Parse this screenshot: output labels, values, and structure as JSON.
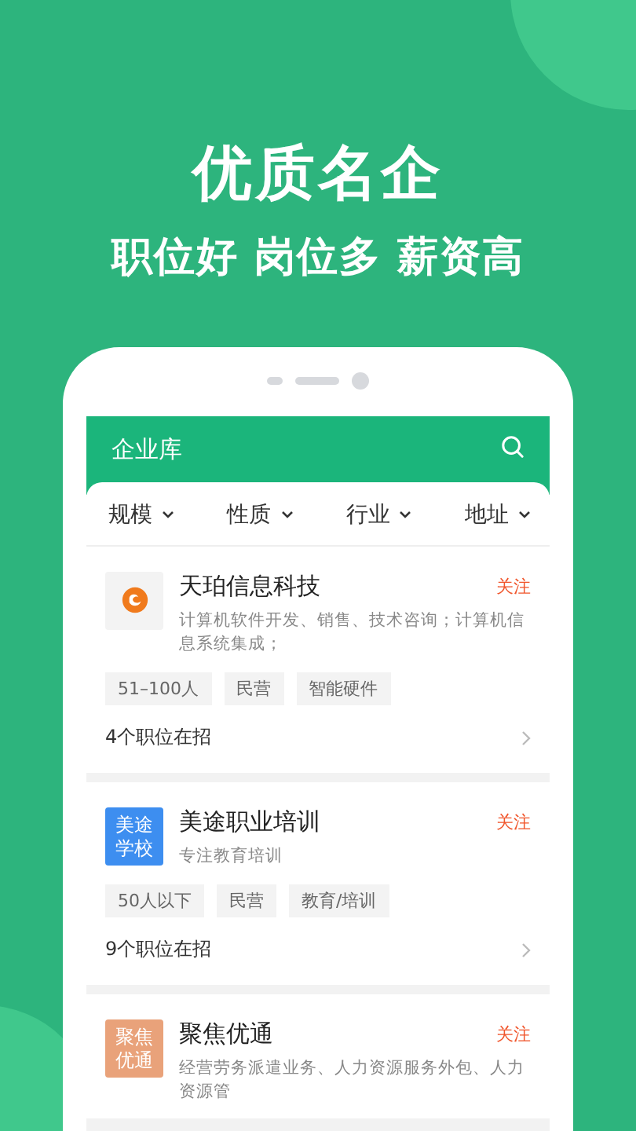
{
  "headline": "优质名企",
  "tagline": "职位好 岗位多 薪资高",
  "screen": {
    "title": "企业库",
    "filters": [
      {
        "label": "规模"
      },
      {
        "label": "性质"
      },
      {
        "label": "行业"
      },
      {
        "label": "地址"
      }
    ],
    "companies": [
      {
        "name": "天珀信息科技",
        "follow": "关注",
        "description": "计算机软件开发、销售、技术咨询；计算机信息系统集成；",
        "tags": [
          "51–100人",
          "民营",
          "智能硬件"
        ],
        "jobs": "4个职位在招"
      },
      {
        "color": "#3d8ef0",
        "logo_text": "美途学校",
        "name": "美途职业培训",
        "follow": "关注",
        "description": "专注教育培训",
        "tags": [
          "50人以下",
          "民营",
          "教育/培训"
        ],
        "jobs": "9个职位在招"
      },
      {
        "color": "#e9a27a",
        "logo_text": "聚焦优通",
        "name": "聚焦优通",
        "follow": "关注",
        "description": "经营劳务派遣业务、人力资源服务外包、人力资源管"
      }
    ]
  }
}
